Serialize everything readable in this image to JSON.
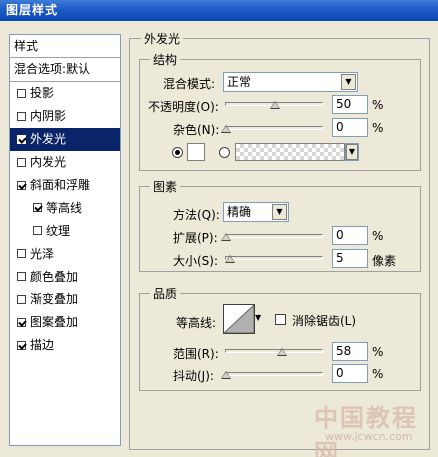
{
  "title": "图层样式",
  "left": {
    "header": "样式",
    "blend": "混合选项:默认",
    "items": [
      {
        "label": "投影",
        "checked": false
      },
      {
        "label": "内阴影",
        "checked": false
      },
      {
        "label": "外发光",
        "checked": true,
        "selected": true
      },
      {
        "label": "内发光",
        "checked": false
      },
      {
        "label": "斜面和浮雕",
        "checked": true
      },
      {
        "label": "等高线",
        "checked": true,
        "indent": true
      },
      {
        "label": "纹理",
        "checked": false,
        "indent": true
      },
      {
        "label": "光泽",
        "checked": false
      },
      {
        "label": "颜色叠加",
        "checked": false
      },
      {
        "label": "渐变叠加",
        "checked": false
      },
      {
        "label": "图案叠加",
        "checked": true
      },
      {
        "label": "描边",
        "checked": true
      }
    ]
  },
  "panel": {
    "title": "外发光",
    "structure": {
      "title": "结构",
      "blend_mode_label": "混合模式:",
      "blend_mode_value": "正常",
      "opacity_label": "不透明度(O):",
      "opacity_value": "50",
      "opacity_unit": "%",
      "noise_label": "杂色(N):",
      "noise_value": "0",
      "noise_unit": "%"
    },
    "elements": {
      "title": "图素",
      "method_label": "方法(Q):",
      "method_value": "精确",
      "spread_label": "扩展(P):",
      "spread_value": "0",
      "spread_unit": "%",
      "size_label": "大小(S):",
      "size_value": "5",
      "size_unit": "像素"
    },
    "quality": {
      "title": "品质",
      "contour_label": "等高线:",
      "antialias_label": "消除锯齿(L)",
      "range_label": "范围(R):",
      "range_value": "58",
      "range_unit": "%",
      "jitter_label": "抖动(J):",
      "jitter_value": "0",
      "jitter_unit": "%"
    }
  },
  "watermark": {
    "main": "中国教程网",
    "url": "www.jcwcn.com"
  }
}
